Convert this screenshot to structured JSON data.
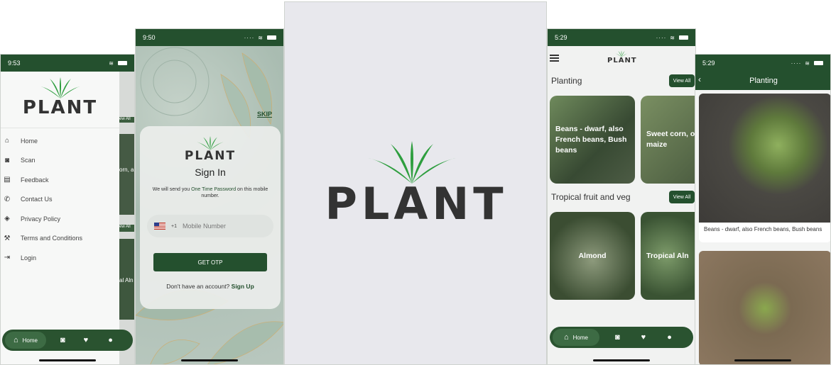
{
  "brand": {
    "word": "PLANT",
    "green": "#24502e",
    "leaf": "#2e9e3f",
    "text": "#333333"
  },
  "phone1": {
    "time": "9:53",
    "menu": [
      {
        "icon": "home-icon",
        "glyph": "⌂",
        "label": "Home"
      },
      {
        "icon": "camera-icon",
        "glyph": "◙",
        "label": "Scan"
      },
      {
        "icon": "feedback-icon",
        "glyph": "▤",
        "label": "Feedback"
      },
      {
        "icon": "phone-icon",
        "glyph": "✆",
        "label": "Contact Us"
      },
      {
        "icon": "shield-icon",
        "glyph": "◈",
        "label": "Privacy Policy"
      },
      {
        "icon": "gavel-icon",
        "glyph": "⚒",
        "label": "Terms and Conditions"
      },
      {
        "icon": "login-icon",
        "glyph": "⇥",
        "label": "Login"
      }
    ],
    "behind_text": [
      "ew All",
      "orn, a",
      "ew All",
      "al Aln"
    ],
    "tab_home": "Home"
  },
  "phone2": {
    "time": "9:50",
    "skip": "SKIP",
    "title": "Sign In",
    "desc_pre": "We will send you ",
    "desc_hl": "One Time Password",
    "desc_post": " on this mobile number.",
    "country_code": "+1",
    "mobile_placeholder": "Mobile Number",
    "otp_button": "GET OTP",
    "signup_prompt": "Don't have an account? ",
    "signup_link": "Sign Up"
  },
  "phone4": {
    "time": "5:29",
    "section1": "Planting",
    "section2": "Tropical fruit and veg",
    "view_all": "View All",
    "cards1": [
      "Beans - dwarf, also French beans, Bush beans",
      "Sweet corn, or maize"
    ],
    "cards2": [
      "Almond",
      "Tropical Aln"
    ],
    "tab_home": "Home"
  },
  "phone5": {
    "time": "5:29",
    "title": "Planting",
    "caption1": "Beans - dwarf, also French beans, Bush beans"
  }
}
